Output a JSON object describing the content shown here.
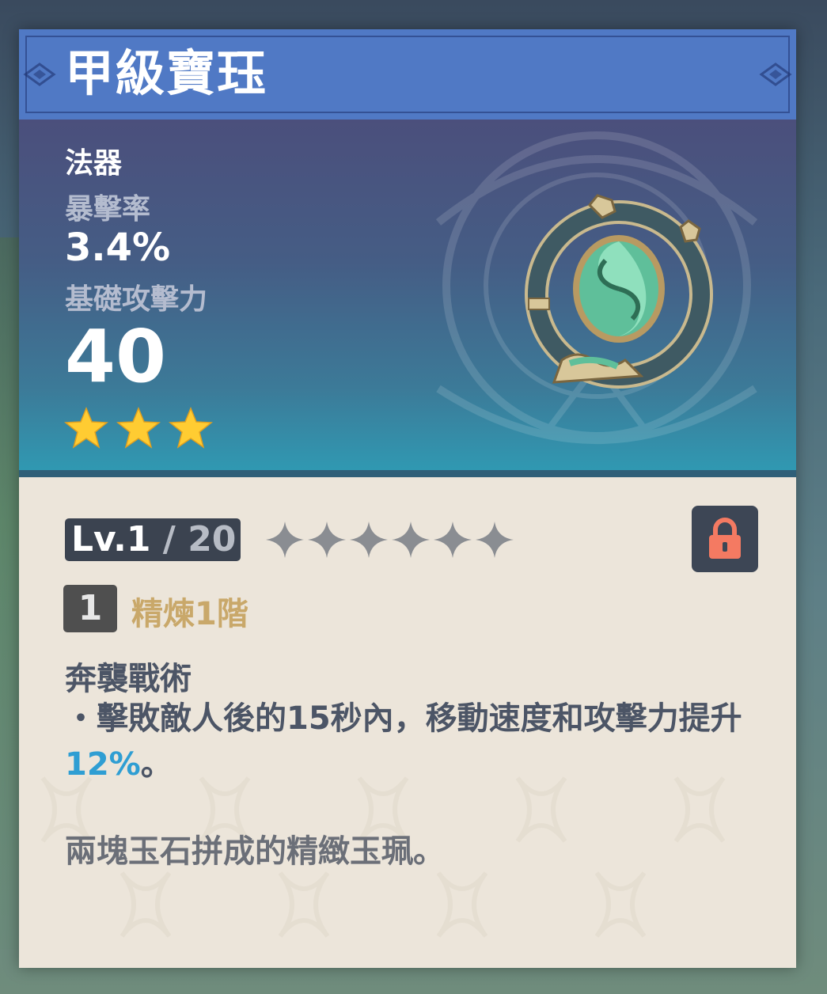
{
  "weapon": {
    "name": "甲級寶珏",
    "type": "法器",
    "secondary_stat_label": "暴擊率",
    "secondary_stat_value": "3.4%",
    "base_atk_label": "基礎攻擊力",
    "base_atk_value": "40",
    "rarity_stars": 3
  },
  "level": {
    "current": "Lv.1",
    "separator": " / ",
    "max": "20",
    "ascension_stars": 6
  },
  "refinement": {
    "rank": "1",
    "label": "精煉1階"
  },
  "passive": {
    "name": "奔襲戰術",
    "desc_before": "・擊敗敵人後的15秒內，移動速度和攻擊力提升",
    "desc_highlight": "12%",
    "desc_after": "。"
  },
  "lore": "兩塊玉石拼成的精緻玉珮。",
  "icons": {
    "lock": "lock-icon",
    "rarity": "star-icon",
    "ascension": "ascension-star-icon"
  },
  "colors": {
    "header": "#5079c5",
    "star": "#ffcc32",
    "highlight": "#2f9ed3",
    "refine_text": "#c9a86a",
    "lock_icon": "#f47a62"
  }
}
